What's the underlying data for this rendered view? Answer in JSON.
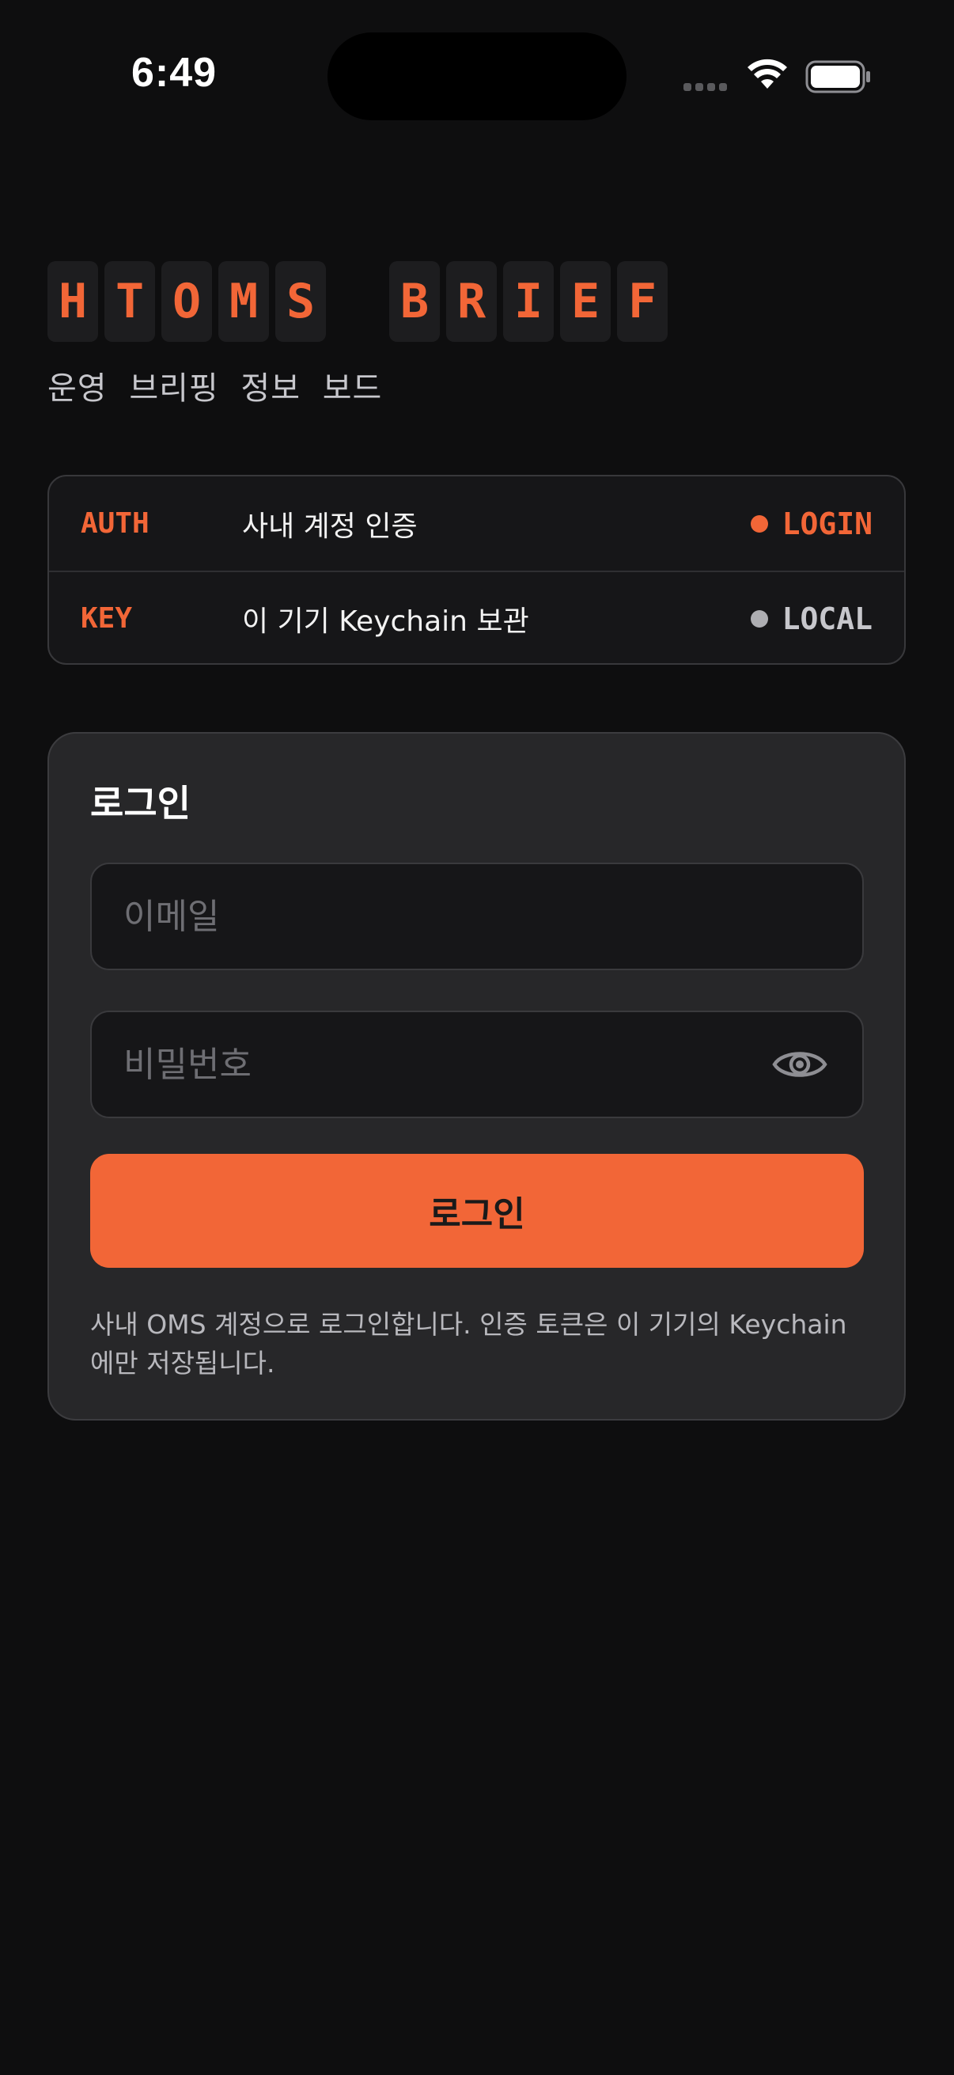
{
  "status_bar": {
    "time": "6:49"
  },
  "brand": {
    "title_letters": [
      "H",
      "T",
      "O",
      "M",
      "S",
      "",
      "B",
      "R",
      "I",
      "E",
      "F"
    ],
    "subtitle": "운영 브리핑 정보 보드"
  },
  "status_rows": [
    {
      "key": "AUTH",
      "description": "사내 계정 인증",
      "value": "LOGIN",
      "dot_color": "#f26637",
      "value_color": "#f26637"
    },
    {
      "key": "KEY",
      "description": "이 기기 Keychain 보관",
      "value": "LOCAL",
      "dot_color": "#aeaeb2",
      "value_color": "#c7c7cc"
    }
  ],
  "login": {
    "title": "로그인",
    "email_placeholder": "이메일",
    "email_value": "",
    "password_placeholder": "비밀번호",
    "password_value": "",
    "password_toggle_icon": "eye-icon",
    "submit_label": "로그인",
    "note": "사내 OMS 계정으로 로그인합니다. 인증 토큰은 이 기기의 Keychain에만 저장됩니다."
  },
  "colors": {
    "accent": "#f26637",
    "background": "#0e0e0f",
    "card": "#272729"
  }
}
